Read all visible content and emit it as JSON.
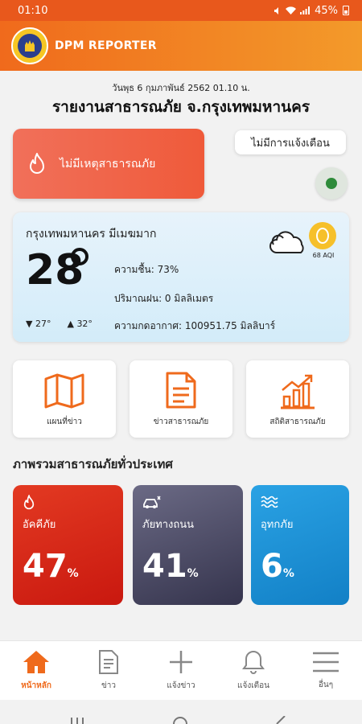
{
  "status_bar": {
    "time": "01:10",
    "battery": "45%"
  },
  "app_bar": {
    "title": "DPM REPORTER"
  },
  "header": {
    "date": "วันพุธ 6 กุมภาพันธ์ 2562 01.10 น.",
    "title": "รายงานสาธารณภัย จ.กรุงเทพมหานคร"
  },
  "alert": {
    "label": "ไม่มีเหตุสาธารณภัย",
    "warning": "ไม่มีการแจ้งเตือน",
    "status_color": "#2e8b3a"
  },
  "weather": {
    "city": "กรุงเทพมหานคร มีเมฆมาก",
    "temp": "28",
    "humidity": "ความชื้น: 73%",
    "rain": "ปริมาณฝน: 0 มิลลิเมตร",
    "pressure": "ความกดอากาศ: 100951.75 มิลลิบาร์",
    "min": "27°",
    "max": "32°",
    "aqi": "68 AQI"
  },
  "quick_links": [
    {
      "label": "แผนที่ข่าว",
      "icon": "map-icon"
    },
    {
      "label": "ข่าวสาธารณภัย",
      "icon": "document-icon"
    },
    {
      "label": "สถิติสาธารณภัย",
      "icon": "bar-chart-icon"
    }
  ],
  "overview": {
    "title": "ภาพรวมสาธารณภัยทั่วประเทศ",
    "unit": "%",
    "cards": [
      {
        "name": "อัคคีภัย",
        "value": "47",
        "icon": "fire-icon",
        "color": "#e0301e"
      },
      {
        "name": "ภัยทางถนน",
        "value": "41",
        "icon": "road-accident-icon",
        "color": "#3f3e5a"
      },
      {
        "name": "อุทกภัย",
        "value": "6",
        "icon": "flood-icon",
        "color": "#1e8fd6"
      }
    ]
  },
  "bottom_nav": [
    {
      "label": "หน้าหลัก",
      "icon": "home-icon",
      "active": true
    },
    {
      "label": "ข่าว",
      "icon": "news-icon"
    },
    {
      "label": "แจ้งข่าว",
      "icon": "plus-icon"
    },
    {
      "label": "แจ้งเตือน",
      "icon": "bell-icon"
    },
    {
      "label": "อื่นๆ",
      "icon": "menu-icon"
    }
  ],
  "colors": {
    "brand": "#ef6a1c",
    "accent": "#f39a2a"
  }
}
